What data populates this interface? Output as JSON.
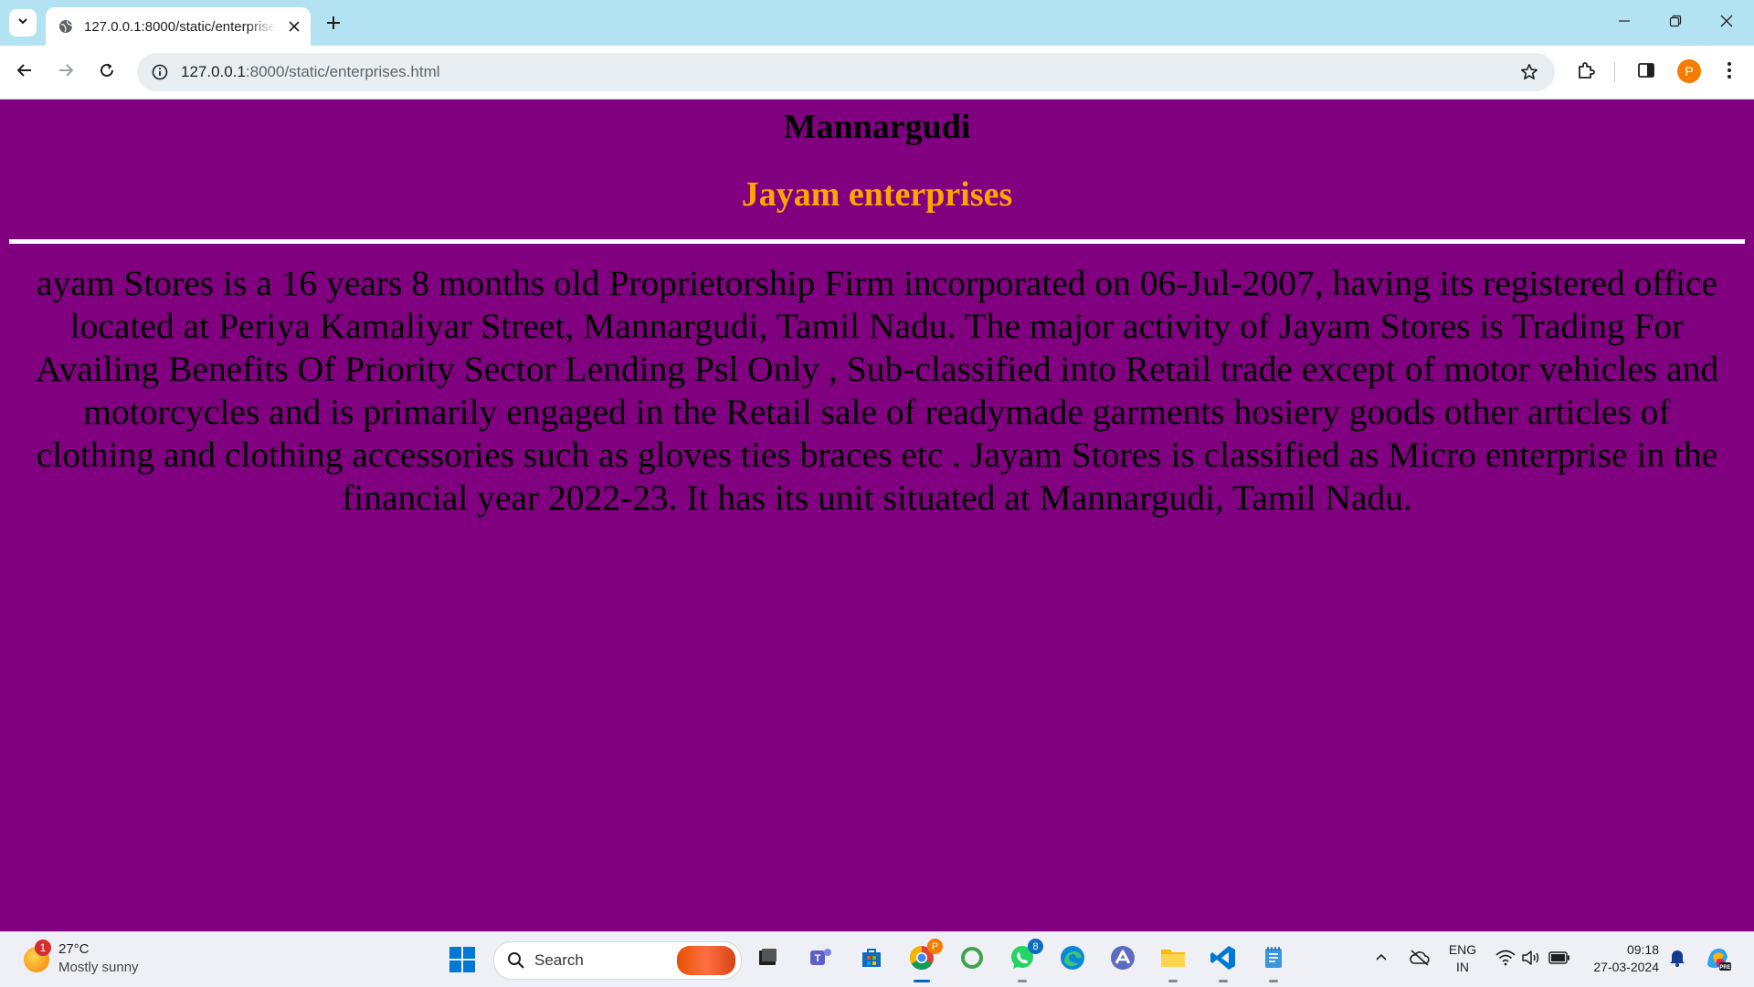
{
  "browser": {
    "tab_title": "127.0.0.1:8000/static/enterprises.html",
    "url_host": "127.0.0.1",
    "url_path": ":8000/static/enterprises.html",
    "profile_initial": "P"
  },
  "page": {
    "city": "Mannargudi",
    "company": "Jayam enterprises",
    "description": "ayam Stores is a 16 years 8 months old Proprietorship Firm incorporated on 06-Jul-2007, having its registered office located at Periya Kamaliyar Street, Mannargudi, Tamil Nadu. The major activity of Jayam Stores is Trading For Availing Benefits Of Priority Sector Lending Psl Only , Sub-classified into Retail trade except of motor vehicles and motorcycles and is primarily engaged in the Retail sale of readymade garments hosiery goods other articles of clothing and clothing accessories such as gloves ties braces etc . Jayam Stores is classified as Micro enterprise in the financial year 2022-23. It has its unit situated at Mannargudi, Tamil Nadu.",
    "background_color": "#800080",
    "company_color": "#ffa500"
  },
  "taskbar": {
    "weather_badge": "1",
    "weather_temp": "27°C",
    "weather_desc": "Mostly sunny",
    "search_label": "Search",
    "whatsapp_badge": "8",
    "chrome_badge": "P",
    "lang_top": "ENG",
    "lang_bottom": "IN",
    "time": "09:18",
    "date": "27-03-2024"
  }
}
